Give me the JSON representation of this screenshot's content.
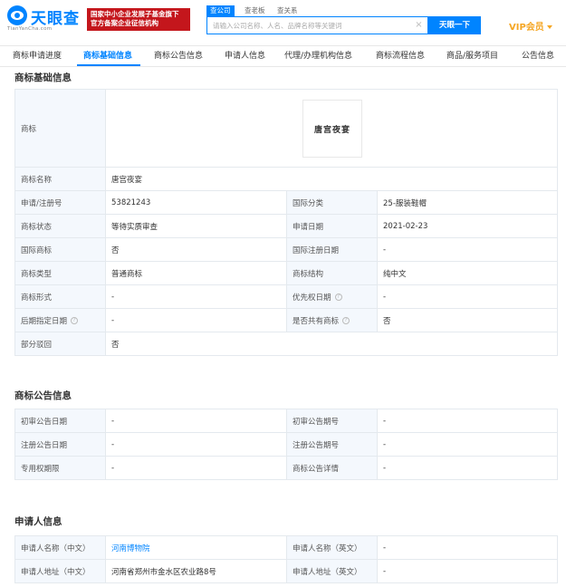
{
  "header": {
    "logo_text": "天眼查",
    "logo_sub": "TianYanCha.com",
    "banner_line1": "国家中小企业发展子基金旗下",
    "banner_line2": "官方备案企业征信机构",
    "search_tabs": [
      "查公司",
      "查老板",
      "查关系"
    ],
    "search_placeholder": "请输入公司名称、人名、品牌名称等关键词",
    "search_button": "天眼一下",
    "vip_label": "VIP会员"
  },
  "nav": {
    "tabs": [
      "商标申请进度",
      "商标基础信息",
      "商标公告信息",
      "申请人信息",
      "代理/办理机构信息",
      "商标流程信息",
      "商品/服务项目",
      "公告信息"
    ]
  },
  "basic": {
    "title": "商标基础信息",
    "trademark_label": "商标",
    "trademark_image_text": "唐宫夜宴",
    "rows": [
      {
        "l1": "商标名称",
        "v1": "唐宫夜宴"
      },
      {
        "l1": "申请/注册号",
        "v1": "53821243",
        "l2": "国际分类",
        "v2": "25-服装鞋帽"
      },
      {
        "l1": "商标状态",
        "v1": "等待实质审查",
        "l2": "申请日期",
        "v2": "2021-02-23"
      },
      {
        "l1": "国际商标",
        "v1": "否",
        "l2": "国际注册日期",
        "v2": "-"
      },
      {
        "l1": "商标类型",
        "v1": "普通商标",
        "l2": "商标结构",
        "v2": "纯中文"
      },
      {
        "l1": "商标形式",
        "v1": "-",
        "l2": "优先权日期",
        "v2": "-"
      },
      {
        "l1": "后期指定日期",
        "v1": "-",
        "l2": "是否共有商标",
        "v2": "否"
      },
      {
        "l1": "部分驳回",
        "v1": "否"
      }
    ]
  },
  "announcement": {
    "title": "商标公告信息",
    "rows": [
      {
        "l1": "初审公告日期",
        "v1": "-",
        "l2": "初审公告期号",
        "v2": "-"
      },
      {
        "l1": "注册公告日期",
        "v1": "-",
        "l2": "注册公告期号",
        "v2": "-"
      },
      {
        "l1": "专用权期限",
        "v1": "-",
        "l2": "商标公告详情",
        "v2": "-"
      }
    ]
  },
  "applicant": {
    "title": "申请人信息",
    "rows": [
      {
        "l1": "申请人名称（中文）",
        "v1": "河南博物院",
        "l2": "申请人名称（英文）",
        "v2": "-"
      },
      {
        "l1": "申请人地址（中文）",
        "v1": "河南省郑州市金水区农业路8号",
        "l2": "申请人地址（英文）",
        "v2": "-"
      }
    ]
  }
}
